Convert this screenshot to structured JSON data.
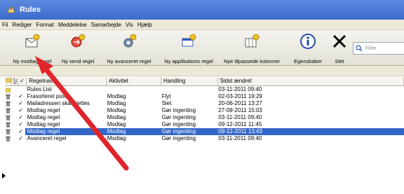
{
  "window": {
    "title": "Rules"
  },
  "menu": [
    "Fil",
    "Rediger",
    "Format",
    "Meddelelse",
    "Samarbejde",
    "Vis",
    "Hjælp"
  ],
  "toolbar": {
    "buttons": [
      {
        "label": "Ny modtag regel",
        "icon": "new-receive-rule-icon"
      },
      {
        "label": "Ny send regel",
        "icon": "new-send-rule-icon"
      },
      {
        "label": "Ny avanceret regel",
        "icon": "new-advanced-rule-icon"
      },
      {
        "label": "Ny applikations regel",
        "icon": "new-application-rule-icon"
      },
      {
        "label": "Nye tilpassede kolonner",
        "icon": "new-custom-columns-icon"
      },
      {
        "label": "Egenskaber",
        "icon": "info-icon"
      },
      {
        "label": "Slet",
        "icon": "delete-x-icon"
      }
    ],
    "filter_placeholder": "Filter"
  },
  "table": {
    "columns": [
      "Regelnavn",
      "Aktivitet",
      "Handling",
      "Sidst ændret"
    ],
    "rows": [
      {
        "name": "Rules List",
        "activity": "",
        "action": "",
        "modified": "03-11-2011 09:40",
        "check": "",
        "icon": "folder"
      },
      {
        "name": "Frasorteret post",
        "activity": "Modtag",
        "action": "Flyt",
        "modified": "02-03-2011 19:29",
        "check": "✓",
        "icon": "trash"
      },
      {
        "name": "Mailadressen skal slettes",
        "activity": "Modtag",
        "action": "Slet",
        "modified": "20-06-2011 13:27",
        "check": "✓",
        "icon": "trash"
      },
      {
        "name": "Modtag regel",
        "activity": "Modtag",
        "action": "Gør ingenting",
        "modified": "27-09-2011 15:03",
        "check": "✓",
        "icon": "trash"
      },
      {
        "name": "Modtag regel",
        "activity": "Modtag",
        "action": "Gør ingenting",
        "modified": "03-11-2011 09:40",
        "check": "✓",
        "icon": "trash"
      },
      {
        "name": "Modtag regel",
        "activity": "Modtag",
        "action": "Gør ingenting",
        "modified": "09-12-2011 11:45",
        "check": "✓",
        "icon": "trash"
      },
      {
        "name": "Modtag regel",
        "activity": "Modtag",
        "action": "Gør ingenting",
        "modified": "09-12-2011 13:43",
        "check": "✓",
        "icon": "trash",
        "selected": true
      },
      {
        "name": "Avanceret regel",
        "activity": "Modtag",
        "action": "Gør ingenting",
        "modified": "03-11-2011 09:40",
        "check": "✓",
        "icon": "trash"
      }
    ]
  },
  "annotation": {
    "arrow_color": "#e0262b"
  },
  "colors": {
    "titlebar": "#3d6bcb",
    "selection": "#3468c8"
  }
}
